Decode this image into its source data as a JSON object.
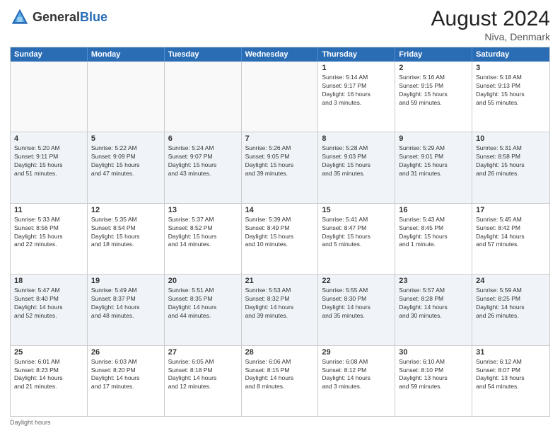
{
  "header": {
    "logo_general": "General",
    "logo_blue": "Blue",
    "month_year": "August 2024",
    "location": "Niva, Denmark"
  },
  "weekdays": [
    "Sunday",
    "Monday",
    "Tuesday",
    "Wednesday",
    "Thursday",
    "Friday",
    "Saturday"
  ],
  "footer": {
    "daylight_label": "Daylight hours"
  },
  "rows": [
    [
      {
        "day": "",
        "info": "",
        "empty": true
      },
      {
        "day": "",
        "info": "",
        "empty": true
      },
      {
        "day": "",
        "info": "",
        "empty": true
      },
      {
        "day": "",
        "info": "",
        "empty": true
      },
      {
        "day": "1",
        "info": "Sunrise: 5:14 AM\nSunset: 9:17 PM\nDaylight: 16 hours\nand 3 minutes."
      },
      {
        "day": "2",
        "info": "Sunrise: 5:16 AM\nSunset: 9:15 PM\nDaylight: 15 hours\nand 59 minutes."
      },
      {
        "day": "3",
        "info": "Sunrise: 5:18 AM\nSunset: 9:13 PM\nDaylight: 15 hours\nand 55 minutes."
      }
    ],
    [
      {
        "day": "4",
        "info": "Sunrise: 5:20 AM\nSunset: 9:11 PM\nDaylight: 15 hours\nand 51 minutes."
      },
      {
        "day": "5",
        "info": "Sunrise: 5:22 AM\nSunset: 9:09 PM\nDaylight: 15 hours\nand 47 minutes."
      },
      {
        "day": "6",
        "info": "Sunrise: 5:24 AM\nSunset: 9:07 PM\nDaylight: 15 hours\nand 43 minutes."
      },
      {
        "day": "7",
        "info": "Sunrise: 5:26 AM\nSunset: 9:05 PM\nDaylight: 15 hours\nand 39 minutes."
      },
      {
        "day": "8",
        "info": "Sunrise: 5:28 AM\nSunset: 9:03 PM\nDaylight: 15 hours\nand 35 minutes."
      },
      {
        "day": "9",
        "info": "Sunrise: 5:29 AM\nSunset: 9:01 PM\nDaylight: 15 hours\nand 31 minutes."
      },
      {
        "day": "10",
        "info": "Sunrise: 5:31 AM\nSunset: 8:58 PM\nDaylight: 15 hours\nand 26 minutes."
      }
    ],
    [
      {
        "day": "11",
        "info": "Sunrise: 5:33 AM\nSunset: 8:56 PM\nDaylight: 15 hours\nand 22 minutes."
      },
      {
        "day": "12",
        "info": "Sunrise: 5:35 AM\nSunset: 8:54 PM\nDaylight: 15 hours\nand 18 minutes."
      },
      {
        "day": "13",
        "info": "Sunrise: 5:37 AM\nSunset: 8:52 PM\nDaylight: 15 hours\nand 14 minutes."
      },
      {
        "day": "14",
        "info": "Sunrise: 5:39 AM\nSunset: 8:49 PM\nDaylight: 15 hours\nand 10 minutes."
      },
      {
        "day": "15",
        "info": "Sunrise: 5:41 AM\nSunset: 8:47 PM\nDaylight: 15 hours\nand 5 minutes."
      },
      {
        "day": "16",
        "info": "Sunrise: 5:43 AM\nSunset: 8:45 PM\nDaylight: 15 hours\nand 1 minute."
      },
      {
        "day": "17",
        "info": "Sunrise: 5:45 AM\nSunset: 8:42 PM\nDaylight: 14 hours\nand 57 minutes."
      }
    ],
    [
      {
        "day": "18",
        "info": "Sunrise: 5:47 AM\nSunset: 8:40 PM\nDaylight: 14 hours\nand 52 minutes."
      },
      {
        "day": "19",
        "info": "Sunrise: 5:49 AM\nSunset: 8:37 PM\nDaylight: 14 hours\nand 48 minutes."
      },
      {
        "day": "20",
        "info": "Sunrise: 5:51 AM\nSunset: 8:35 PM\nDaylight: 14 hours\nand 44 minutes."
      },
      {
        "day": "21",
        "info": "Sunrise: 5:53 AM\nSunset: 8:32 PM\nDaylight: 14 hours\nand 39 minutes."
      },
      {
        "day": "22",
        "info": "Sunrise: 5:55 AM\nSunset: 8:30 PM\nDaylight: 14 hours\nand 35 minutes."
      },
      {
        "day": "23",
        "info": "Sunrise: 5:57 AM\nSunset: 8:28 PM\nDaylight: 14 hours\nand 30 minutes."
      },
      {
        "day": "24",
        "info": "Sunrise: 5:59 AM\nSunset: 8:25 PM\nDaylight: 14 hours\nand 26 minutes."
      }
    ],
    [
      {
        "day": "25",
        "info": "Sunrise: 6:01 AM\nSunset: 8:23 PM\nDaylight: 14 hours\nand 21 minutes."
      },
      {
        "day": "26",
        "info": "Sunrise: 6:03 AM\nSunset: 8:20 PM\nDaylight: 14 hours\nand 17 minutes."
      },
      {
        "day": "27",
        "info": "Sunrise: 6:05 AM\nSunset: 8:18 PM\nDaylight: 14 hours\nand 12 minutes."
      },
      {
        "day": "28",
        "info": "Sunrise: 6:06 AM\nSunset: 8:15 PM\nDaylight: 14 hours\nand 8 minutes."
      },
      {
        "day": "29",
        "info": "Sunrise: 6:08 AM\nSunset: 8:12 PM\nDaylight: 14 hours\nand 3 minutes."
      },
      {
        "day": "30",
        "info": "Sunrise: 6:10 AM\nSunset: 8:10 PM\nDaylight: 13 hours\nand 59 minutes."
      },
      {
        "day": "31",
        "info": "Sunrise: 6:12 AM\nSunset: 8:07 PM\nDaylight: 13 hours\nand 54 minutes."
      }
    ]
  ]
}
